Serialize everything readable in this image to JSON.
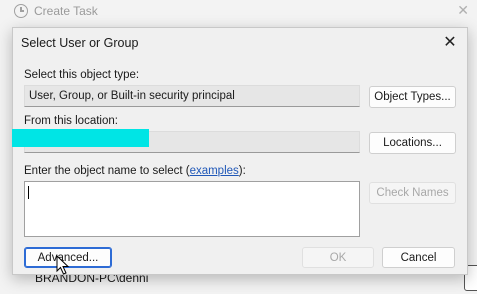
{
  "background": {
    "title": "Create Task",
    "bottom_text": "BRANDON-PC\\denni"
  },
  "dialog": {
    "title": "Select User or Group",
    "object_type_label": "Select this object type:",
    "object_type_value": "User, Group, or Built-in security principal",
    "object_types_button": "Object Types...",
    "location_label": "From this location:",
    "location_value": "",
    "locations_button": "Locations...",
    "enter_label_prefix": "Enter the object name to select (",
    "enter_label_link": "examples",
    "enter_label_suffix": "):",
    "object_name_value": "",
    "check_names_button": "Check Names",
    "advanced_button": "Advanced...",
    "ok_button": "OK",
    "cancel_button": "Cancel"
  },
  "colors": {
    "redaction": "#00e5e5",
    "link": "#2058b8",
    "focus": "#2d6bd5"
  }
}
